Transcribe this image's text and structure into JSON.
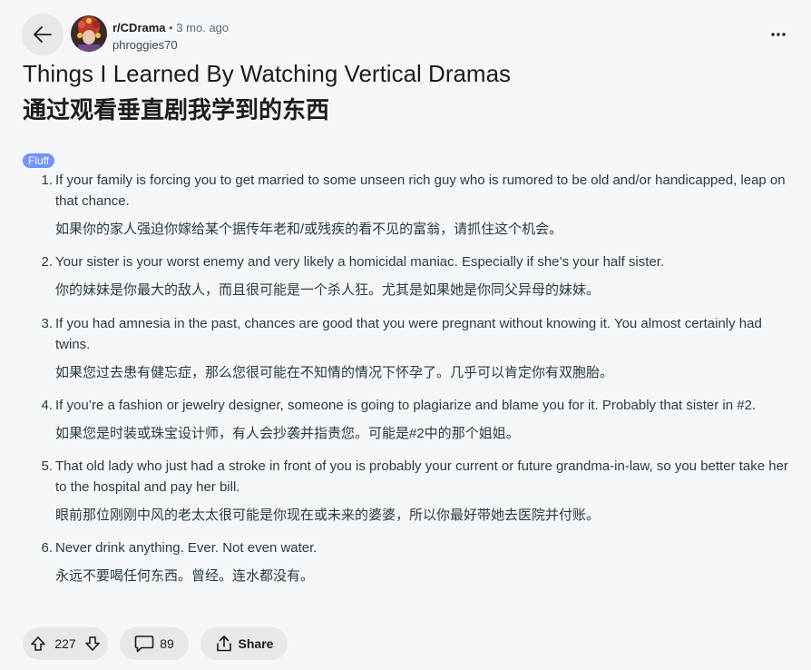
{
  "post": {
    "subreddit": "r/CDrama",
    "time": "• 3 mo. ago",
    "author": "phroggies70",
    "title_en": "Things I Learned By Watching Vertical Dramas",
    "title_zh": "通过观看垂直剧我学到的东西",
    "flair": "Fluff"
  },
  "items": [
    {
      "num": "1.",
      "en": "If your family is forcing you to get married to some unseen rich guy who is rumored to be old and/or handicapped, leap on that chance.",
      "zh": "如果你的家人强迫你嫁给某个据传年老和/或残疾的看不见的富翁，请抓住这个机会。"
    },
    {
      "num": "2.",
      "en": "Your sister is your worst enemy and very likely a homicidal maniac. Especially if she’s your half sister.",
      "zh": "你的妹妹是你最大的敌人，而且很可能是一个杀人狂。尤其是如果她是你同父异母的妹妹。"
    },
    {
      "num": "3.",
      "en": "If you had amnesia in the past, chances are good that you were pregnant without knowing it. You almost certainly had twins.",
      "zh": "如果您过去患有健忘症，那么您很可能在不知情的情况下怀孕了。几乎可以肯定你有双胞胎。"
    },
    {
      "num": "4.",
      "en": "If you’re a fashion or jewelry designer, someone is going to plagiarize and blame you for it. Probably that sister in #2.",
      "zh": "如果您是时装或珠宝设计师，有人会抄袭并指责您。可能是#2中的那个姐姐。"
    },
    {
      "num": "5.",
      "en": "That old lady who just had a stroke in front of you is probably your current or future grandma-in-law, so you better take her to the hospital and pay her bill.",
      "zh": "眼前那位刚刚中风的老太太很可能是你现在或未来的婆婆，所以你最好带她去医院并付账。"
    },
    {
      "num": "6.",
      "en": "Never drink anything. Ever. Not even water.",
      "zh": "永远不要喝任何东西。曾经。连水都没有。"
    }
  ],
  "actions": {
    "upvotes": "227",
    "comments": "89",
    "share_label": "Share"
  },
  "icons": {
    "back": "back-arrow-icon",
    "more": "more-dots-icon",
    "upvote": "upvote-arrow-icon",
    "downvote": "downvote-arrow-icon",
    "comment": "comment-bubble-icon",
    "share": "share-icon"
  },
  "colors": {
    "flair_bg": "#7193ff",
    "pill_bg": "#e6e8ea",
    "page_bg": "#f6f7f9"
  }
}
